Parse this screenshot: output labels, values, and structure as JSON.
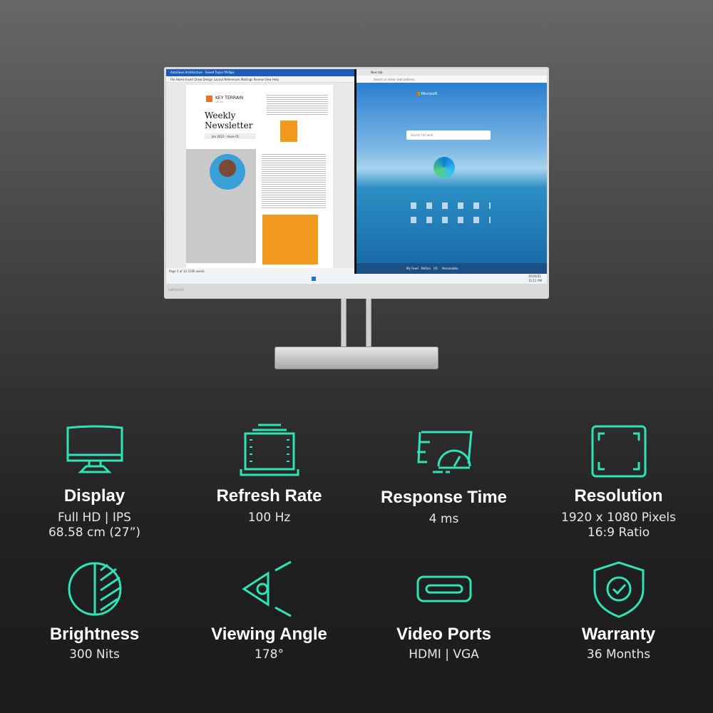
{
  "accent_color": "#2fe3b6",
  "monitor": {
    "brand": "Lenovo",
    "word": {
      "title_bar": "AutoSave  Architecture - Saved  Taylor Phillips",
      "ribbon": "File  Home  Insert  Draw  Design  Layout  References  Mailings  Review  View  Help",
      "company": "KEY TERRAIN",
      "company_sub": "GROUP",
      "heading": "Weekly Newsletter",
      "date": "Jan 2022",
      "issue": "Issue 01",
      "status": "Page 2 of 10  2190 words"
    },
    "edge": {
      "tab": "New tab",
      "address_placeholder": "Search or enter web address",
      "brand": "Microsoft",
      "search_placeholder": "Search the web",
      "feed_tabs": [
        "My Feed",
        "Politics",
        "US"
      ],
      "personalize": "Personalize"
    },
    "taskbar": {
      "date": "10/20/21",
      "time": "11:11 AM"
    }
  },
  "features": [
    {
      "icon": "curved-monitor-icon",
      "title": "Display",
      "lines": [
        "Full HD | IPS",
        "68.58 cm (27”)"
      ]
    },
    {
      "icon": "refresh-frames-icon",
      "title": "Refresh Rate",
      "lines": [
        "100 Hz"
      ]
    },
    {
      "icon": "speedometer-icon",
      "title": "Response Time",
      "lines": [
        "4 ms"
      ]
    },
    {
      "icon": "resolution-frame-icon",
      "title": "Resolution",
      "lines": [
        "1920 x 1080 Pixels",
        "16:9 Ratio"
      ]
    },
    {
      "icon": "brightness-half-icon",
      "title": "Brightness",
      "lines": [
        "300 Nits"
      ]
    },
    {
      "icon": "eye-angle-icon",
      "title": "Viewing Angle",
      "lines": [
        "178°"
      ]
    },
    {
      "icon": "port-icon",
      "title": "Video Ports",
      "lines": [
        "HDMI | VGA"
      ]
    },
    {
      "icon": "shield-check-icon",
      "title": "Warranty",
      "lines": [
        "36 Months"
      ]
    }
  ]
}
